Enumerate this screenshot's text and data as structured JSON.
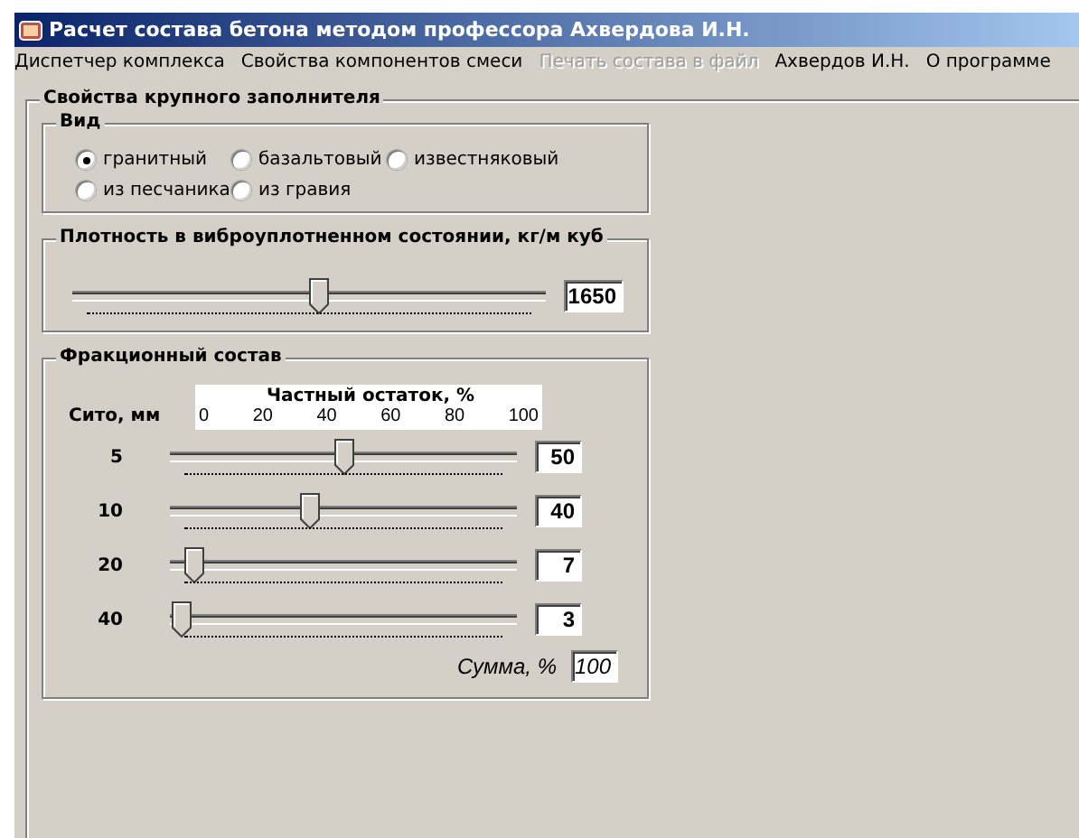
{
  "window": {
    "title": "Расчет состава бетона методом профессора Ахвердова И.Н."
  },
  "menu": [
    {
      "label": "Диспетчер комплекса",
      "disabled": false
    },
    {
      "label": "Свойства компонентов смеси",
      "disabled": false
    },
    {
      "label": "Печать состава  в файл",
      "disabled": true
    },
    {
      "label": "Ахвердов И.Н.",
      "disabled": false
    },
    {
      "label": "О программе",
      "disabled": false
    }
  ],
  "aggregate": {
    "title": "Свойства крупного заполнителя",
    "type_group": {
      "title": "Вид",
      "options": [
        {
          "label": "гранитный",
          "selected": true
        },
        {
          "label": "базальтовый",
          "selected": false
        },
        {
          "label": "известняковый",
          "selected": false
        },
        {
          "label": "из песчаника",
          "selected": false
        },
        {
          "label": "из гравия",
          "selected": false
        }
      ]
    },
    "density": {
      "title": "Плотность в виброуплотненном состоянии, кг/м куб",
      "level": 0.52,
      "value": "1650"
    },
    "fractions": {
      "title": "Фракционный состав",
      "sieve_label": "Сито,  мм",
      "scale_title": "Частный остаток, %",
      "scale_ticks": [
        "0",
        "20",
        "40",
        "60",
        "80",
        "100"
      ],
      "rows": [
        {
          "sieve": "5",
          "level": 0.5,
          "value": "50"
        },
        {
          "sieve": "10",
          "level": 0.4,
          "value": "40"
        },
        {
          "sieve": "20",
          "level": 0.07,
          "value": "7"
        },
        {
          "sieve": "40",
          "level": 0.03,
          "value": "3"
        }
      ],
      "sum_label": "Сумма, %",
      "sum_value": "100"
    }
  }
}
